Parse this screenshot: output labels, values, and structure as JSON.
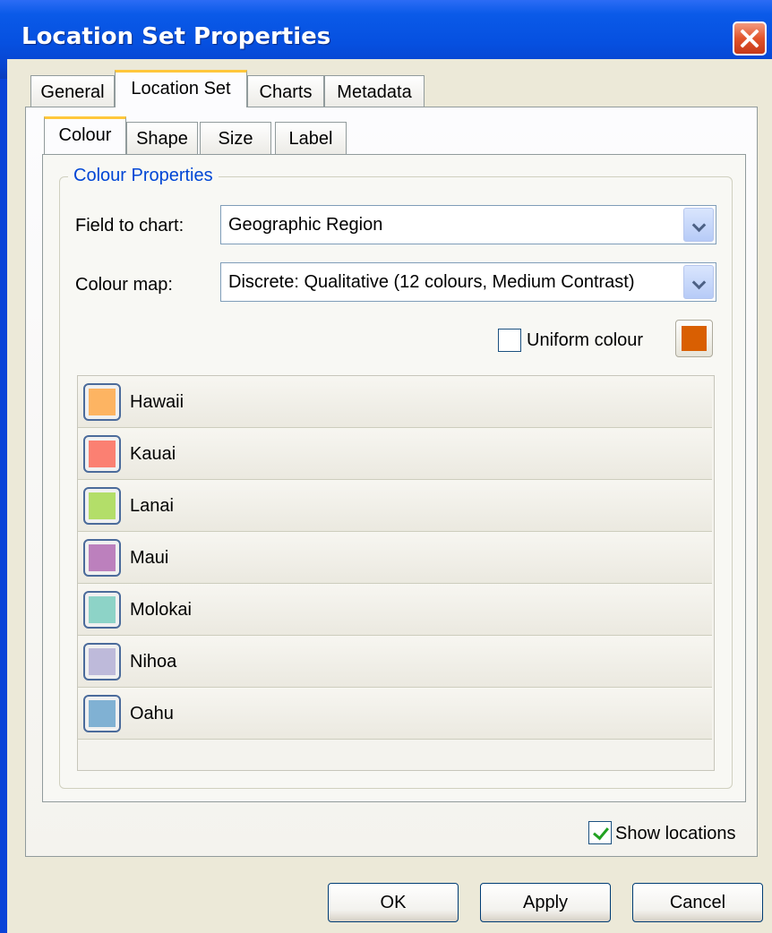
{
  "window": {
    "title": "Location Set Properties"
  },
  "tabs": [
    "General",
    "Location Set",
    "Charts",
    "Metadata"
  ],
  "subtabs": [
    "Colour",
    "Shape",
    "Size",
    "Label"
  ],
  "group": {
    "legend": "Colour Properties"
  },
  "field_to_chart": {
    "label": "Field to chart:",
    "value": "Geographic Region"
  },
  "colour_map": {
    "label": "Colour map:",
    "value": "Discrete: Qualitative (12 colours, Medium Contrast)"
  },
  "uniform_colour": {
    "label": "Uniform colour",
    "checked": false,
    "color": "#d95f02"
  },
  "items": [
    {
      "label": "Hawaii",
      "color": "#fdb462"
    },
    {
      "label": "Kauai",
      "color": "#fb8072"
    },
    {
      "label": "Lanai",
      "color": "#b3de69"
    },
    {
      "label": "Maui",
      "color": "#bc80bd"
    },
    {
      "label": "Molokai",
      "color": "#8dd3c7"
    },
    {
      "label": "Nihoa",
      "color": "#bebada"
    },
    {
      "label": "Oahu",
      "color": "#80b1d3"
    }
  ],
  "show_locations": {
    "label": "Show locations",
    "checked": true
  },
  "buttons": {
    "ok": "OK",
    "apply": "Apply",
    "cancel": "Cancel"
  }
}
